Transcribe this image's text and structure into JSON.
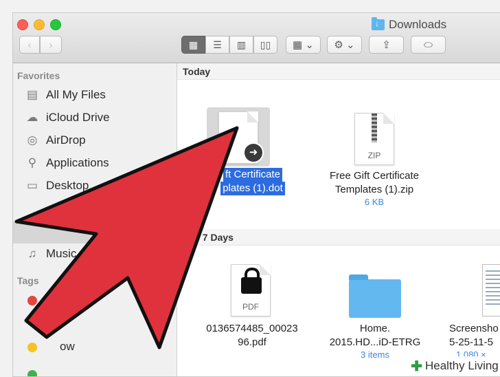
{
  "window": {
    "title": "Downloads"
  },
  "toolbar": {
    "back_icon": "‹",
    "forward_icon": "›",
    "views": [
      "icon-view",
      "list-view",
      "column-view",
      "coverflow-view"
    ],
    "arrange_icon": "▦ ⌄",
    "action_icon": "⚙ ⌄",
    "share_icon": "⇪",
    "tag_icon": "⬭"
  },
  "sidebar": {
    "favorites_label": "Favorites",
    "items": [
      {
        "label": "All My Files",
        "icon": "▤"
      },
      {
        "label": "iCloud Drive",
        "icon": "☁"
      },
      {
        "label": "AirDrop",
        "icon": "◎"
      },
      {
        "label": "Applications",
        "icon": "⚲"
      },
      {
        "label": "Desktop",
        "icon": "▭"
      },
      {
        "label": "Music",
        "icon": "♫"
      }
    ],
    "tags_label": "Tags",
    "tags": [
      {
        "label": "",
        "color": "#e8453c"
      },
      {
        "label": "ow",
        "color": "#f5c323"
      },
      {
        "label": "",
        "color": "#38b64a"
      }
    ]
  },
  "groups": {
    "today": "Today",
    "previous": "ous 7 Days"
  },
  "files": {
    "dot": {
      "line1": "ft Certificate",
      "line2": "plates (1).dot"
    },
    "zip": {
      "line1": "Free Gift Certificate",
      "line2": "Templates (1).zip",
      "size": "6 KB",
      "badge": "ZIP"
    },
    "pdf": {
      "line1": "0136574485_00023",
      "line2": "96.pdf",
      "badge": "PDF"
    },
    "folder": {
      "line1": "Home.",
      "line2": "2015.HD...iD-ETRG",
      "size": "3 items"
    },
    "screenshot": {
      "line1": "Screensho",
      "line2": "5-25-11-5",
      "size": "1,080 ×"
    }
  },
  "brand": {
    "text": "Healthy Living"
  },
  "colors": {
    "arrow": "#e0323c",
    "selection": "#2c6ce0"
  }
}
